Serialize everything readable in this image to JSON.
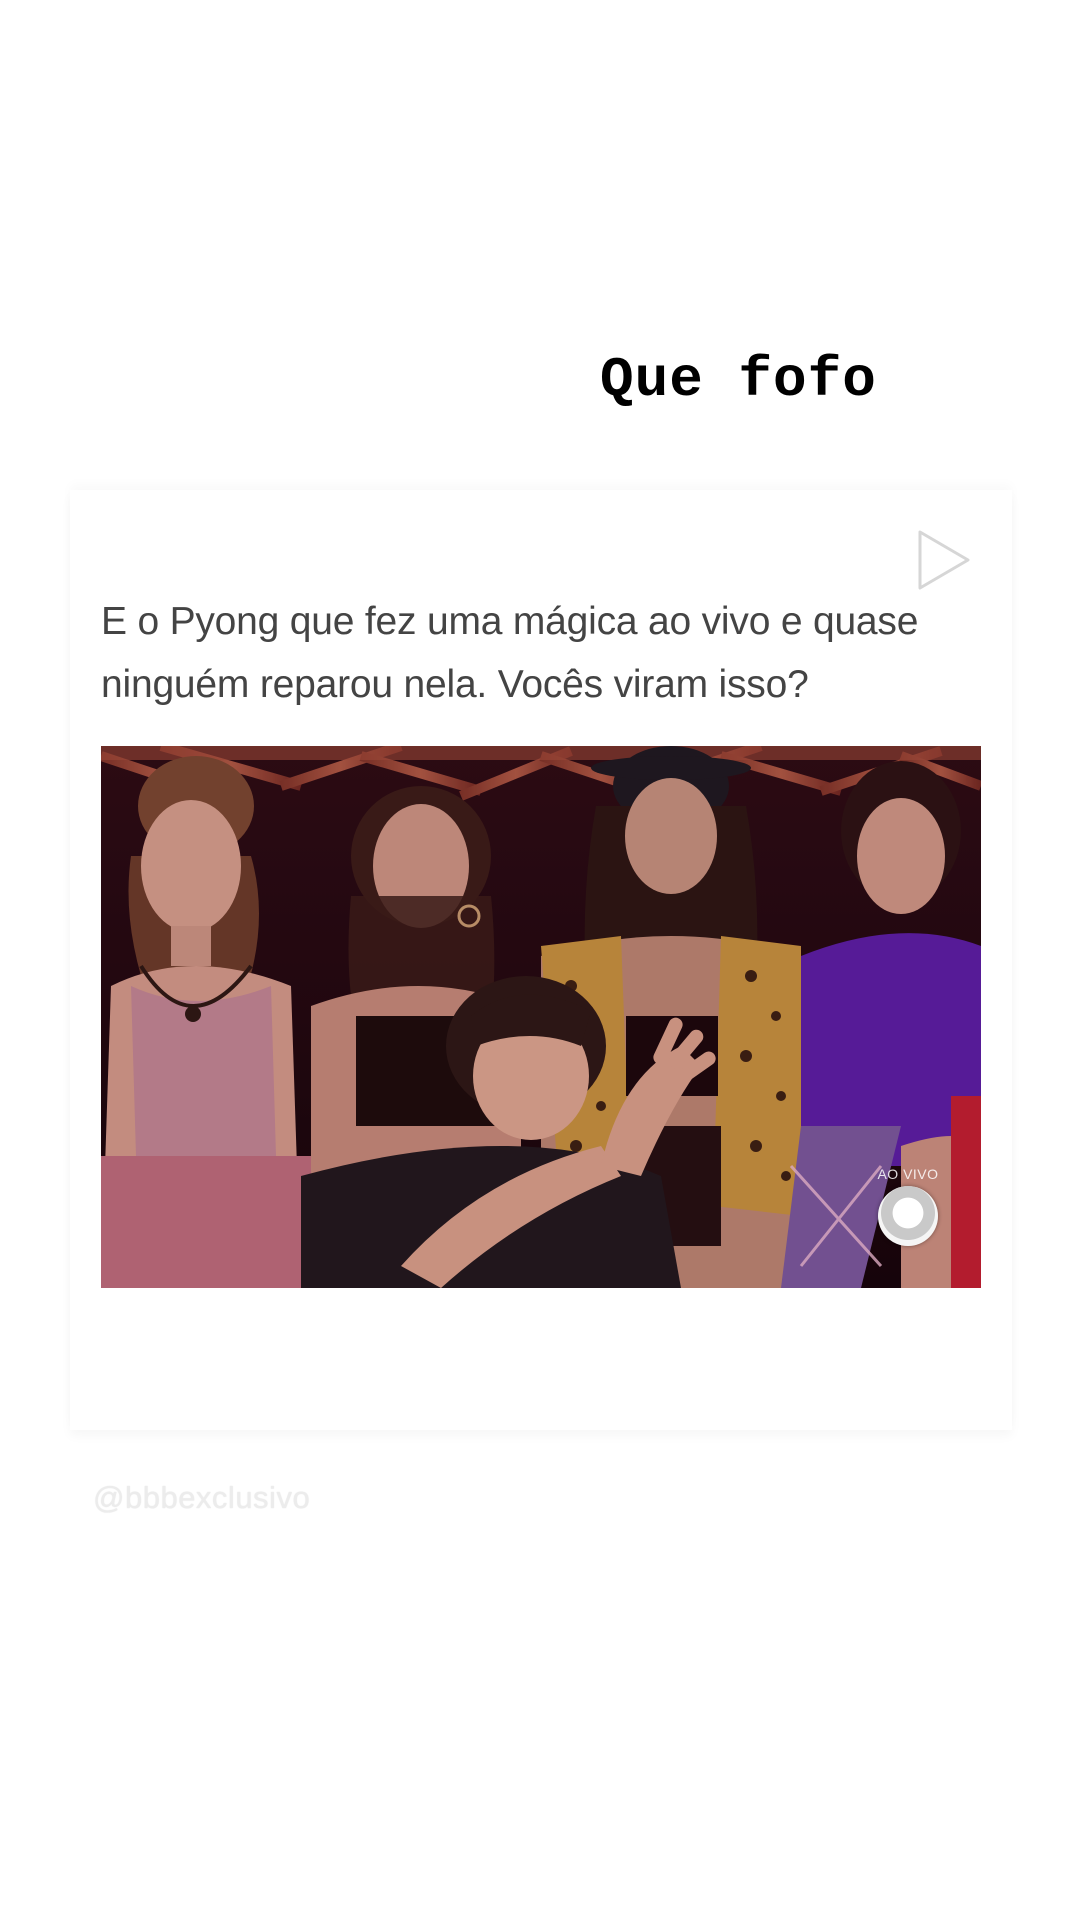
{
  "story": {
    "caption": "Que fofo"
  },
  "post": {
    "text": "E o Pyong que fez uma mágica ao vivo e quase ninguém reparou nela. Vocês viram isso?",
    "media_type": "video",
    "play_icon": "play-icon",
    "live_label": "AO VIVO",
    "broadcaster_logo": "globo-logo-icon"
  },
  "watermark": {
    "handle": "@bbbexclusivo"
  },
  "colors": {
    "background": "#ffffff",
    "caption_text": "#000000",
    "post_text": "#444444",
    "watermark_text": "#ececec"
  }
}
